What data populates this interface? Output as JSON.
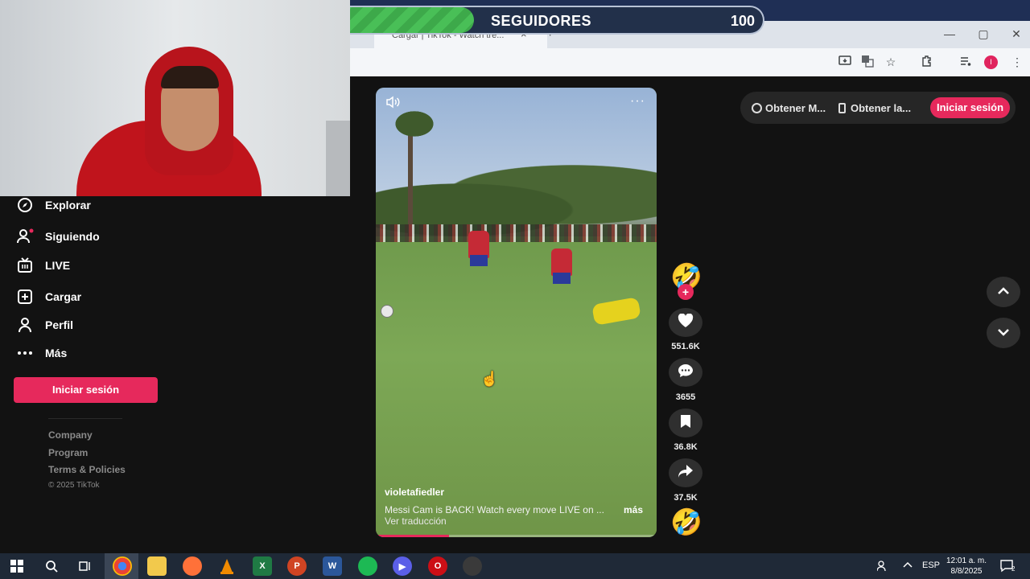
{
  "overlay": {
    "label": "SEGUIDORES",
    "count": "100",
    "progress_fraction": 0.3
  },
  "browser": {
    "tab_title": "Cargar | TikTok - Watch tre...",
    "tab_close": "×",
    "new_tab": "+",
    "window_controls": [
      "—",
      "▢",
      "✕"
    ],
    "profile_initial": "I"
  },
  "sidebar": {
    "items": [
      {
        "label": "Explorar",
        "icon": "compass-icon"
      },
      {
        "label": "Siguiendo",
        "icon": "following-icon"
      },
      {
        "label": "LIVE",
        "icon": "live-tv-icon"
      },
      {
        "label": "Cargar",
        "icon": "upload-plus-icon"
      },
      {
        "label": "Perfil",
        "icon": "profile-icon"
      },
      {
        "label": "Más",
        "icon": "more-dots-icon"
      }
    ],
    "login_label": "Iniciar sesión",
    "footer_links": [
      "Company",
      "Program",
      "Terms & Policies"
    ],
    "copyright": "© 2025 TikTok"
  },
  "video": {
    "more_label": "···",
    "author": "violetafiedler",
    "caption": "Messi Cam is BACK! Watch every move LIVE on ...",
    "more_link": "más",
    "translate": "Ver traducción",
    "progress_fraction": 0.26
  },
  "actions": {
    "avatar_emoji": "🤣",
    "plus": "+",
    "likes": "551.6K",
    "comments": "3655",
    "saves": "36.8K",
    "shares": "37.5K",
    "music_emoji": "🤣"
  },
  "top_bar": {
    "get_app": "Obtener M...",
    "get_desktop": "Obtener la...",
    "login": "Iniciar sesión"
  },
  "taskbar": {
    "language": "ESP",
    "time": "12:01 a. m.",
    "date": "8/8/2025",
    "notifications": "2"
  },
  "colors": {
    "accent": "#e6295c",
    "overlay_green": "#49bf57"
  }
}
